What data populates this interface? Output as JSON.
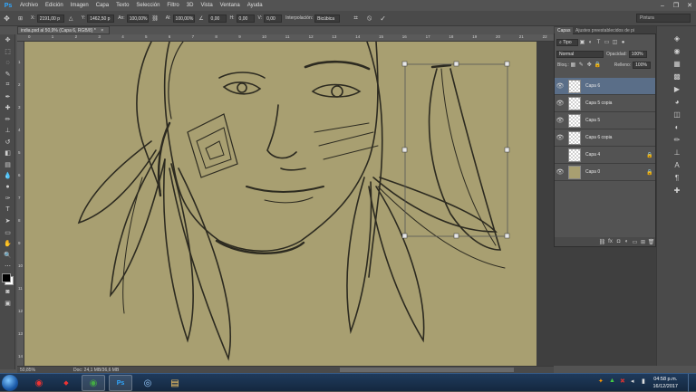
{
  "app": {
    "logo": "Ps"
  },
  "menu": [
    "Archivo",
    "Edición",
    "Imagen",
    "Capa",
    "Texto",
    "Selección",
    "Filtro",
    "3D",
    "Vista",
    "Ventana",
    "Ayuda"
  ],
  "window_controls": [
    "–",
    "❐",
    "✕"
  ],
  "options": {
    "x_label": "X:",
    "x_value": "2191,00 p",
    "y_label": "Y:",
    "y_value": "1462,50 p",
    "w_label": "An:",
    "w_value": "100,00%",
    "h_label": "Al:",
    "h_value": "100,00%",
    "angle_value": "0,00",
    "hskew_label": "H:",
    "hskew_value": "0,00",
    "vskew_label": "V:",
    "vskew_value": "0,00",
    "interp_label": "Interpolación:",
    "interp_value": "Bicúbica"
  },
  "workspace": {
    "value": "Pintura"
  },
  "document": {
    "tab_title": "india.psd al 50,9% (Capa 6, RGB/8) *",
    "close": "×"
  },
  "ruler": {
    "h_ticks": [
      "0",
      "1",
      "2",
      "3",
      "4",
      "5",
      "6",
      "7",
      "8",
      "9",
      "10",
      "11",
      "12",
      "13",
      "14",
      "15",
      "16",
      "17",
      "18",
      "19",
      "20",
      "21",
      "22"
    ],
    "v_ticks": [
      "1",
      "2",
      "3",
      "4",
      "5",
      "6",
      "7",
      "8",
      "9",
      "10",
      "11",
      "12",
      "13",
      "14"
    ]
  },
  "status": {
    "zoom": "50,85%",
    "doc": "Doc: 24,1 MB/36,6 MB"
  },
  "layers_panel": {
    "tabs": [
      "Capas",
      "Ajustes preestablecidos de pi"
    ],
    "filter_label": "Tipo",
    "blend_mode": "Normal",
    "opacity_label": "Opacidad:",
    "opacity_value": "100%",
    "lock_label": "Bloq.:",
    "fill_label": "Relleno:",
    "fill_value": "100%",
    "layers": [
      {
        "name": "Capa 6",
        "visible": true,
        "selected": true,
        "locked": false
      },
      {
        "name": "Capa 5 copia",
        "visible": true,
        "selected": false,
        "locked": false
      },
      {
        "name": "Capa 5",
        "visible": true,
        "selected": false,
        "locked": false
      },
      {
        "name": "Capa 6 copia",
        "visible": true,
        "selected": false,
        "locked": false
      },
      {
        "name": "Capa 4",
        "visible": false,
        "selected": false,
        "locked": true
      },
      {
        "name": "Capa 0",
        "visible": true,
        "selected": false,
        "locked": true
      }
    ]
  },
  "taskbar": {
    "time": "04:58 p.m.",
    "date": "16/12/2017"
  }
}
